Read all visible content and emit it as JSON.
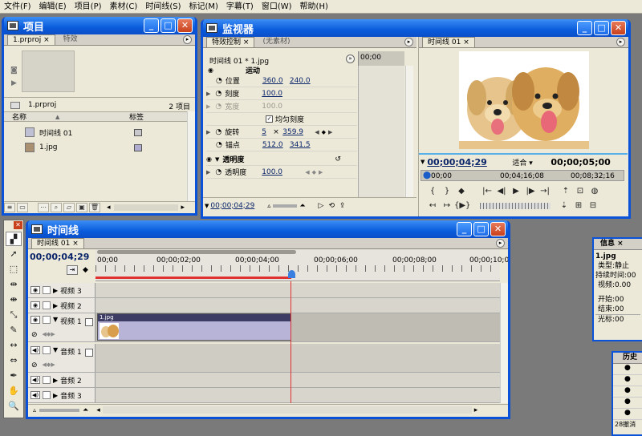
{
  "menu": [
    "文件(F)",
    "编辑(E)",
    "项目(P)",
    "素材(C)",
    "时间线(S)",
    "标记(M)",
    "字幕(T)",
    "窗口(W)",
    "帮助(H)"
  ],
  "project": {
    "title": "项目",
    "tab_file": "1.prproj",
    "tab_effects": "特效",
    "bin_path": "1.prproj",
    "item_count": "2 项目",
    "col_name": "名称",
    "col_label": "标签",
    "items": [
      {
        "name": "时间线 01",
        "icon": "sequence-icon",
        "color": "#c8c8cc"
      },
      {
        "name": "1.jpg",
        "icon": "image-file-icon",
        "color": "#b0acd0"
      }
    ]
  },
  "monitor": {
    "title": "监视器",
    "tab_effect_controls": "特效控制",
    "tab_no_clip": "(无素材)",
    "tab_timeline": "时间线 01",
    "ec_header": "时间线 01 * 1.jpg",
    "ec_ruler_time": "00;00",
    "motion_label": "运动",
    "props": [
      {
        "name": "位置",
        "v1": "360.0",
        "v2": "240.0"
      },
      {
        "name": "刻度",
        "v1": "100.0",
        "v2": ""
      },
      {
        "name": "宽度",
        "v1": "100.0",
        "v2": ""
      },
      {
        "name": "均匀刻度",
        "v1": "",
        "v2": ""
      },
      {
        "name": "旋转",
        "v1": "5",
        "x": "×",
        "v2": "359.9"
      },
      {
        "name": "锚点",
        "v1": "512.0",
        "v2": "341.5"
      }
    ],
    "opacity_group": "透明度",
    "opacity_label": "透明度",
    "opacity_value": "100.0",
    "ec_time": "00;00;04;29",
    "program_time": "00;00;04;29",
    "fit_label": "适合",
    "program_duration": "00;00;05;00",
    "mini_ruler": [
      "00;00",
      "00;04;16;08",
      "00;08;32;16"
    ]
  },
  "timeline": {
    "title": "时间线",
    "tab": "时间线 01",
    "current_time": "00;00;04;29",
    "ruler": [
      "00;00",
      "00;00;02;00",
      "00;00;04;00",
      "00;00;06;00",
      "00;00;08;00",
      "00;00;10;0"
    ],
    "tracks": [
      {
        "name": "视频 3"
      },
      {
        "name": "视频 2"
      },
      {
        "name": "视频 1",
        "clip": "1.jpg"
      },
      {
        "name": "音频 1"
      },
      {
        "name": "音频 2"
      },
      {
        "name": "音频 3"
      }
    ]
  },
  "info": {
    "title": "信息",
    "file": "1.jpg",
    "type_label": "类型:",
    "type_value": "静止",
    "duration_label": "持续时间:",
    "duration_value": "00",
    "video_label": "视频:",
    "video_value": "0.00",
    "start_label": "开始:",
    "start_value": "00",
    "end_label": "结束:",
    "end_value": "00",
    "cursor_label": "光标:",
    "cursor_value": "00"
  },
  "history": {
    "title": "历史",
    "footer": "28撤消"
  },
  "colors": {
    "accent": "#0a52d8",
    "playhead": "#e03030",
    "clip": "#b8b4d8"
  }
}
